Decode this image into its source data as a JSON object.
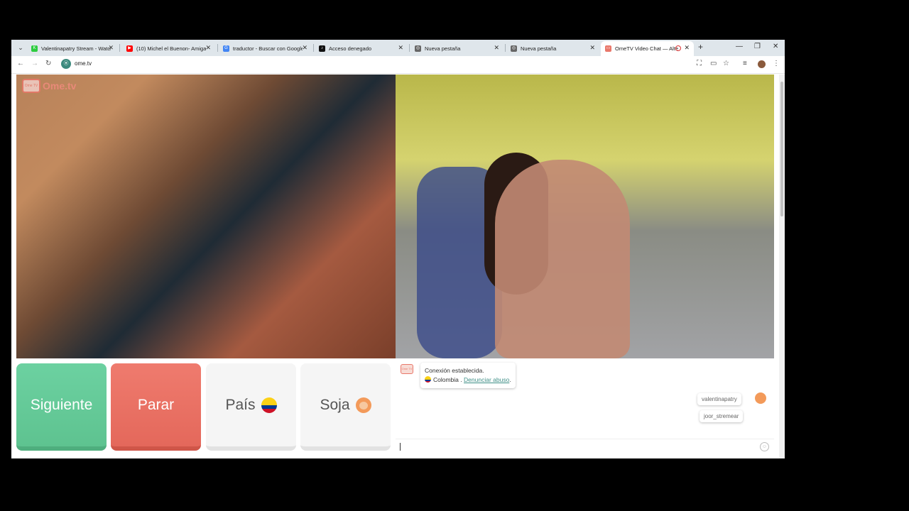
{
  "browser": {
    "tabs": [
      {
        "title": "Valentinapatry Stream - Watch",
        "favicon_color": "#2ecc40",
        "favicon_glyph": "K"
      },
      {
        "title": "(10) Michel el Buenon- Amiga",
        "favicon_color": "#ff0000",
        "favicon_glyph": "▶"
      },
      {
        "title": "traductor - Buscar con Google",
        "favicon_color": "#4285f4",
        "favicon_glyph": "G"
      },
      {
        "title": "Acceso denegado",
        "favicon_color": "#111111",
        "favicon_glyph": "♪"
      },
      {
        "title": "Nueva pestaña",
        "favicon_color": "#666666",
        "favicon_glyph": "◎"
      },
      {
        "title": "Nueva pestaña",
        "favicon_color": "#666666",
        "favicon_glyph": "◎"
      },
      {
        "title": "OmeTV Video Chat — Alte",
        "favicon_color": "#e9776a",
        "favicon_glyph": "▭",
        "active": true
      }
    ],
    "url": "ome.tv"
  },
  "video": {
    "logo_text": "Ome.tv",
    "logo_tv_text": "Ome TV"
  },
  "controls": {
    "next_label": "Siguiente",
    "stop_label": "Parar",
    "country_label": "País",
    "gender_label": "Soja",
    "country_flag_colors": [
      "#fcd116",
      "#003893",
      "#ce1126"
    ]
  },
  "chat": {
    "system_line1": "Conexión establecida.",
    "country": "Colombia",
    "separator": ".",
    "report_link": "Denunciar abuso",
    "period": ".",
    "messages": [
      {
        "text": "valentinapatry"
      },
      {
        "text": "joor_stremear"
      }
    ]
  },
  "colors": {
    "next": "#5ec390",
    "stop": "#e4685b",
    "brand": "#e9776a",
    "link": "#3f8f87"
  }
}
